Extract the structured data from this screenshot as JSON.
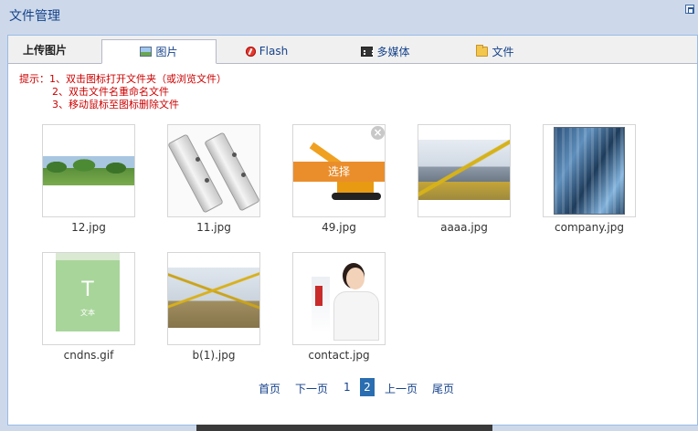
{
  "window": {
    "title": "文件管理"
  },
  "upload_label": "上传图片",
  "tabs": [
    {
      "label": "图片",
      "icon": "image-icon",
      "active": true
    },
    {
      "label": "Flash",
      "icon": "flash-icon",
      "active": false
    },
    {
      "label": "多媒体",
      "icon": "media-icon",
      "active": false
    },
    {
      "label": "文件",
      "icon": "folder-icon",
      "active": false
    }
  ],
  "hints": {
    "line1": "提示：1、双击图标打开文件夹（或浏览文件）",
    "line2": "2、双击文件名重命名文件",
    "line3": "3、移动鼠标至图标删除文件"
  },
  "files": [
    {
      "name": "12.jpg"
    },
    {
      "name": "11.jpg"
    },
    {
      "name": "49.jpg",
      "overlay_label": "选择"
    },
    {
      "name": "aaaa.jpg"
    },
    {
      "name": "company.jpg"
    },
    {
      "name": "cndns.gif",
      "glyph": "T",
      "glyph_sub": "文本"
    },
    {
      "name": "b(1).jpg"
    },
    {
      "name": "contact.jpg"
    }
  ],
  "pagination": {
    "first": "首页",
    "next": "下一页",
    "page1": "1",
    "current": "2",
    "prev": "上一页",
    "last": "尾页"
  },
  "colors": {
    "accent": "#15428b",
    "hint": "#cc0000",
    "select_overlay": "#ea8e2c",
    "current_page": "#2a6db0"
  }
}
